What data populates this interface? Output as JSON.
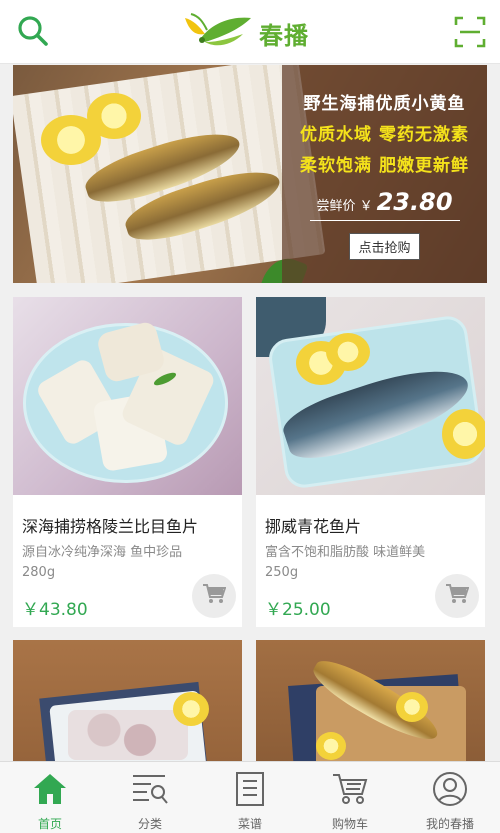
{
  "header": {
    "logo_text": "春播",
    "search_icon": "search-icon",
    "scan_icon": "scan-icon",
    "accent_color": "#5fae31"
  },
  "banner": {
    "title": "野生海捕优质小黄鱼",
    "line1": "优质水域 零药无激素",
    "line2": "柔软饱满 肥嫩更新鲜",
    "price_label": "尝鲜价 ￥",
    "price": "23.80",
    "button_label": "点击抢购"
  },
  "products": [
    {
      "name": "深海捕捞格陵兰比目鱼片",
      "desc": "源自冰冷纯净深海 鱼中珍品",
      "weight": "280g",
      "price": "￥43.80"
    },
    {
      "name": "挪威青花鱼片",
      "desc": "富含不饱和脂肪酸 味道鲜美",
      "weight": "250g",
      "price": "￥25.00"
    }
  ],
  "tabs": [
    {
      "label": "首页",
      "icon": "home-icon",
      "active": true
    },
    {
      "label": "分类",
      "icon": "category-icon",
      "active": false
    },
    {
      "label": "菜谱",
      "icon": "recipe-icon",
      "active": false
    },
    {
      "label": "购物车",
      "icon": "cart-icon",
      "active": false
    },
    {
      "label": "我的春播",
      "icon": "profile-icon",
      "active": false
    }
  ],
  "colors": {
    "price": "#32a852",
    "promo_yellow": "#f4e21b",
    "active_tab": "#32a852"
  }
}
